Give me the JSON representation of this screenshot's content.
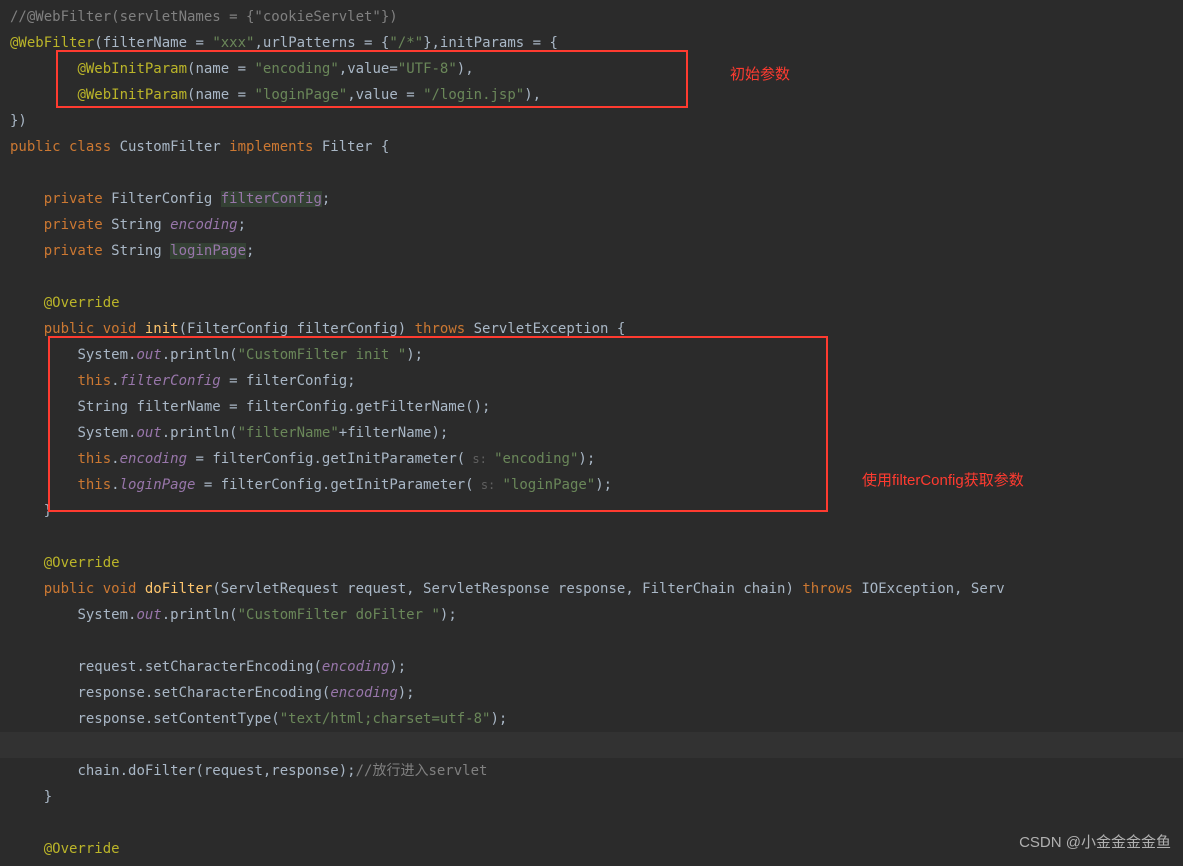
{
  "labels": {
    "initParams": "初始参数",
    "useFilterConfig": "使用filterConfig获取参数",
    "watermark": "CSDN @小金金金金鱼"
  },
  "code": {
    "l1_comment": "//@WebFilter(servletNames = {\"cookieServlet\"})",
    "l2_anno": "@WebFilter",
    "l2_p1": "(",
    "l2_filterName": "filterName = ",
    "l2_xxx": "\"xxx\"",
    "l2_comma1": ",",
    "l2_urlPatterns": "urlPatterns = {",
    "l2_slashstar": "\"/*\"",
    "l2_close1": "},",
    "l2_initParams": "initParams = {",
    "l3_anno": "@WebInitParam",
    "l3_open": "(",
    "l3_name": "name = ",
    "l3_encoding": "\"encoding\"",
    "l3_comma": ",",
    "l3_value": "value=",
    "l3_utf8": "\"UTF-8\"",
    "l3_close": "),",
    "l4_anno": "@WebInitParam",
    "l4_open": "(",
    "l4_name": "name = ",
    "l4_loginPage": "\"loginPage\"",
    "l4_comma": ",",
    "l4_value": "value = ",
    "l4_jsp": "\"/login.jsp\"",
    "l4_close": "),",
    "l5": "})",
    "l6_public": "public class ",
    "l6_class": "CustomFilter ",
    "l6_implements": "implements ",
    "l6_filter": "Filter {",
    "l8_private": "private ",
    "l8_type": "FilterConfig ",
    "l8_field": "filterConfig",
    "l8_semi": ";",
    "l9_private": "private ",
    "l9_type": "String ",
    "l9_field": "encoding",
    "l9_semi": ";",
    "l10_private": "private ",
    "l10_type": "String ",
    "l10_field": "loginPage",
    "l10_semi": ";",
    "l12_override": "@Override",
    "l13_public": "public void ",
    "l13_method": "init",
    "l13_params": "(FilterConfig filterConfig) ",
    "l13_throws": "throws ",
    "l13_exc": "ServletException {",
    "l14_sys": "System.",
    "l14_out": "out",
    "l14_println": ".println(",
    "l14_str": "\"CustomFilter init \"",
    "l14_close": ");",
    "l15_this": "this",
    "l15_dot": ".",
    "l15_field": "filterConfig",
    "l15_eq": " = filterConfig;",
    "l16": "String filterName = filterConfig.getFilterName();",
    "l17_sys": "System.",
    "l17_out": "out",
    "l17_println": ".println(",
    "l17_str": "\"filterName\"",
    "l17_plus": "+filterName);",
    "l18_this": "this",
    "l18_dot": ".",
    "l18_field": "encoding",
    "l18_eq": " = filterConfig.getInitParameter(",
    "l18_hint": " s: ",
    "l18_str": "\"encoding\"",
    "l18_close": ");",
    "l19_this": "this",
    "l19_dot": ".",
    "l19_field": "loginPage",
    "l19_eq": " = filterConfig.getInitParameter(",
    "l19_hint": " s: ",
    "l19_str": "\"loginPage\"",
    "l19_close": ");",
    "l20": "}",
    "l22_override": "@Override",
    "l23_public": "public void ",
    "l23_method": "doFilter",
    "l23_params": "(ServletRequest request, ServletResponse response, FilterChain chain) ",
    "l23_throws": "throws ",
    "l23_exc": "IOException, Serv",
    "l24_sys": "System.",
    "l24_out": "out",
    "l24_println": ".println(",
    "l24_str": "\"CustomFilter doFilter \"",
    "l24_close": ");",
    "l26_req": "request.setCharacterEncoding(",
    "l26_enc": "encoding",
    "l26_close": ");",
    "l27_resp": "response.setCharacterEncoding(",
    "l27_enc": "encoding",
    "l27_close": ");",
    "l28_resp": "response.setContentType(",
    "l28_str": "\"text/html;charset=utf-8\"",
    "l28_close": ");",
    "l30_chain": "chain.doFilter(request,response);",
    "l30_comment": "//放行进入servlet",
    "l31": "}",
    "l33_override": "@Override"
  }
}
